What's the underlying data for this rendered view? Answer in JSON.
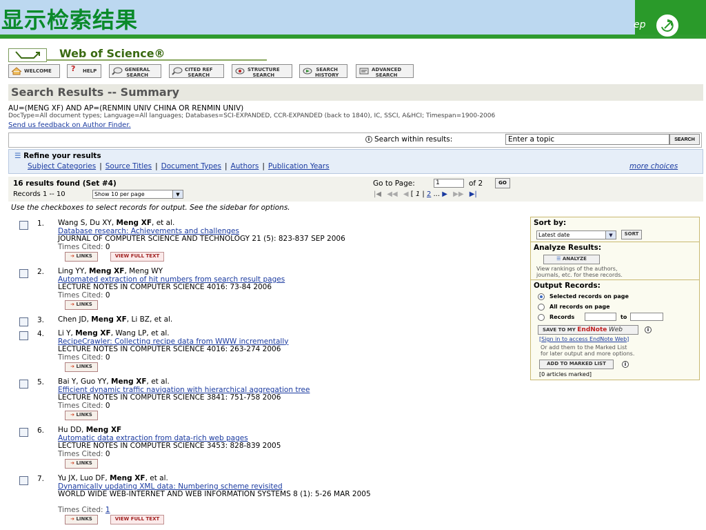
{
  "slide": {
    "title": "显示检索结果",
    "step_text": "ep"
  },
  "header": {
    "logo_text": "Web of Science®"
  },
  "navbar": [
    {
      "label1": "WELCOME",
      "label2": "",
      "icon": "home-icon"
    },
    {
      "label1": "HELP",
      "label2": "",
      "icon": "help-icon"
    },
    {
      "label1": "GENERAL",
      "label2": "SEARCH",
      "icon": "magnifier-icon"
    },
    {
      "label1": "CITED REF",
      "label2": "SEARCH",
      "icon": "magnifier-icon"
    },
    {
      "label1": "STRUCTURE",
      "label2": "SEARCH",
      "icon": "structure-icon"
    },
    {
      "label1": "SEARCH",
      "label2": "HISTORY",
      "icon": "history-icon"
    },
    {
      "label1": "ADVANCED",
      "label2": "SEARCH",
      "icon": "advanced-icon"
    }
  ],
  "summary": {
    "heading": "Search Results -- Summary",
    "query": "AU=(MENG XF) AND AP=(RENMIN UNIV CHINA OR RENMIN UNIV)",
    "doctype": "DocType=All document types; Language=All languages; Databases=SCI-EXPANDED, CCR-EXPANDED (back to 1840), IC, SSCI, A&HCI; Timespan=1900-2006",
    "feedback": "Send us feedback on Author Finder."
  },
  "search_within": {
    "label": "Search within results:",
    "value": "Enter a topic",
    "button": "SEARCH"
  },
  "refine": {
    "title": "Refine your results",
    "links": [
      "Subject Categories",
      "Source Titles",
      "Document Types",
      "Authors",
      "Publication Years"
    ],
    "more": "more choices"
  },
  "results_bar": {
    "found": "16 results found (Set #4)",
    "records": "Records 1 -- 10",
    "per_page": "Show 10 per page",
    "goto_label": "Go to Page:",
    "page_value": "1",
    "of_label": "of 2",
    "go_button": "GO",
    "page_current": "1",
    "page_next": "2",
    "ellipsis": "..."
  },
  "instructions": "Use the checkboxes to select records for output. See the sidebar for options.",
  "records": [
    {
      "num": "1.",
      "authors_pre": "Wang S, Du XY, ",
      "authors_bold": "Meng XF",
      "authors_post": ", et al.",
      "title": "Database research: Achievements and challenges",
      "source": "JOURNAL OF COMPUTER SCIENCE AND TECHNOLOGY 21 (5): 823-837 SEP 2006",
      "times_cited_label": "Times Cited:",
      "times_cited": "0",
      "links": "LINKS",
      "full_text": "VIEW FULL TEXT"
    },
    {
      "num": "2.",
      "authors_pre": "Ling YY, ",
      "authors_bold": "Meng XF",
      "authors_post": ", Meng WY",
      "title": "Automated extraction of hit numbers from search result pages",
      "source": "LECTURE NOTES IN COMPUTER SCIENCE 4016: 73-84 2006",
      "times_cited_label": "Times Cited:",
      "times_cited": "0",
      "links": "LINKS",
      "full_text": ""
    },
    {
      "num": "3.",
      "authors_pre": "Chen JD, ",
      "authors_bold": "Meng XF",
      "authors_post": ", Li BZ, et al.",
      "title": "",
      "source": "",
      "times_cited_label": "",
      "times_cited": "",
      "links": "",
      "full_text": ""
    },
    {
      "num": "4.",
      "authors_pre": "Li Y, ",
      "authors_bold": "Meng XF",
      "authors_post": ", Wang LP, et al.",
      "title": "RecipeCrawler: Collecting recipe data from WWW incrementally",
      "source": "LECTURE NOTES IN COMPUTER SCIENCE 4016: 263-274 2006",
      "times_cited_label": "Times Cited:",
      "times_cited": "0",
      "links": "LINKS",
      "full_text": ""
    },
    {
      "num": "5.",
      "authors_pre": "Bai Y, Guo YY, ",
      "authors_bold": "Meng XF",
      "authors_post": ", et al.",
      "title": "Efficient dynamic traffic navigation with hierarchical aggregation tree",
      "source": "LECTURE NOTES IN COMPUTER SCIENCE 3841: 751-758 2006",
      "times_cited_label": "Times Cited:",
      "times_cited": "0",
      "links": "LINKS",
      "full_text": ""
    },
    {
      "num": "6.",
      "authors_pre": "Hu DD, ",
      "authors_bold": "Meng XF",
      "authors_post": "",
      "title": "Automatic data extraction from data-rich web pages",
      "source": "LECTURE NOTES IN COMPUTER SCIENCE 3453: 828-839 2005",
      "times_cited_label": "Times Cited:",
      "times_cited": "0",
      "links": "LINKS",
      "full_text": ""
    },
    {
      "num": "7.",
      "authors_pre": "Yu JX, Luo DF, ",
      "authors_bold": "Meng XF",
      "authors_post": ", et al.",
      "title": "Dynamically updating XML data: Numbering scheme revisited",
      "source": "WORLD WIDE WEB-INTERNET AND WEB INFORMATION SYSTEMS 8 (1): 5-26 MAR 2005",
      "times_cited_label": "Times Cited:",
      "times_cited": "1",
      "links": "LINKS",
      "full_text": "VIEW FULL TEXT"
    }
  ],
  "sidebar": {
    "sort_title": "Sort by:",
    "sort_value": "Latest date",
    "sort_button": "SORT",
    "analyze_title": "Analyze Results:",
    "analyze_button": "ANALYZE",
    "analyze_note1": "View rankings of the authors,",
    "analyze_note2": "journals, etc. for these records.",
    "output_title": "Output Records:",
    "opt_selected": "Selected records on page",
    "opt_all": "All records on page",
    "opt_records": "Records",
    "opt_to": "to",
    "endnote_prefix": "SAVE TO MY",
    "endnote_brand": "EndNote",
    "endnote_web": "Web",
    "signin_link": "Sign in to access EndNote Web",
    "note1": "Or add them to the Marked List",
    "note2": "for later output and more options.",
    "marked_button": "ADD TO MARKED LIST",
    "marked_count": "[0 articles marked]"
  }
}
